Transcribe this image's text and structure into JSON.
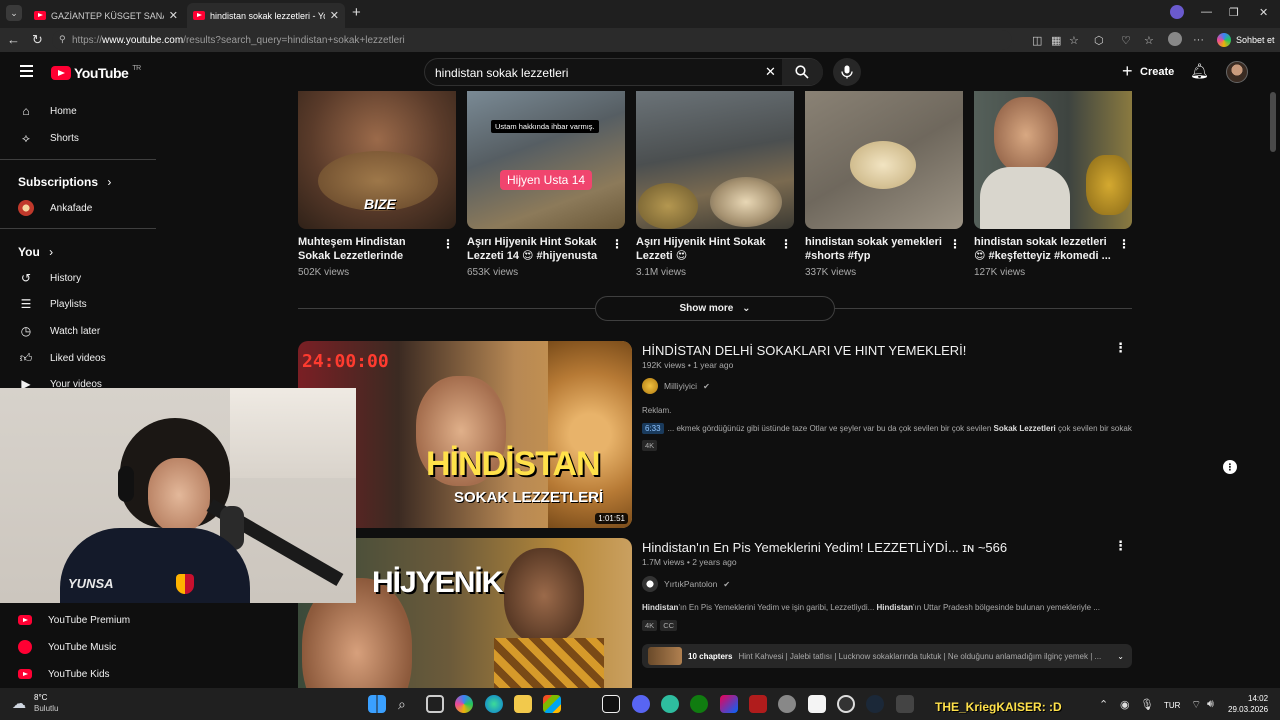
{
  "browser": {
    "tabs": [
      {
        "title": "GAZİANTEP KÜSGET SANAYİ LEZZ",
        "active": false
      },
      {
        "title": "hindistan sokak lezzetleri - YouTub",
        "active": true
      }
    ],
    "url_prefix": "https://",
    "url_host": "www.youtube.com",
    "url_path": "/results?search_query=hindistan+sokak+lezzetleri",
    "copilot_label": "Sohbet et"
  },
  "masthead": {
    "region": "TR",
    "brand": "YouTube",
    "search_value": "hindistan sokak lezzetleri",
    "create_label": "Create"
  },
  "sidebar": {
    "home": "Home",
    "shorts": "Shorts",
    "subscriptions_heading": "Subscriptions",
    "subscription_channel": "Ankafade",
    "you_heading": "You",
    "history": "History",
    "playlists": "Playlists",
    "watch_later": "Watch later",
    "liked_videos": "Liked videos",
    "your_videos": "Your videos",
    "premium": "YouTube Premium",
    "music": "YouTube Music",
    "kids": "YouTube Kids"
  },
  "shorts": [
    {
      "title": "Muhteşem Hindistan Sokak Lezzetlerinde Bugün..",
      "views": "502K views",
      "overlay": "BIZE"
    },
    {
      "title": "Aşırı Hijyenik Hint Sokak Lezzeti 14 😍 #hijyenusta",
      "views": "653K views",
      "overlay": "Hijyen Usta 14",
      "caption": "Ustam hakkında ihbar varmış."
    },
    {
      "title": "Aşırı Hijyenik Hint Sokak Lezzeti 😍",
      "views": "3.1M views"
    },
    {
      "title": "hindistan sokak yemekleri #shorts #fyp",
      "views": "337K views"
    },
    {
      "title": "hindistan sokak lezzetleri 😍 #keşfetteyiz #komedi ...",
      "views": "127K views"
    }
  ],
  "show_more_label": "Show more",
  "videos": [
    {
      "title": "HİNDİSTAN DELHİ SOKAKLARI VE HINT YEMEKLERİ!",
      "meta": "192K views • 1 year ago",
      "channel": "Milliyiyici",
      "desc_head": "Reklam.",
      "timestamp": "6:33",
      "desc_pre": "... ekmek gördüğünüz gibi üstünde taze Otlar ve şeyler var bu da çok sevilen bir çok sevilen ",
      "desc_bold": "Sokak Lezzetleri",
      "desc_post": " çok sevilen bir sokak...",
      "badges": [
        "4K"
      ],
      "duration": "1:01:51",
      "thumb_text_1": "HİNDİSTAN",
      "thumb_text_2": "SOKAK LEZZETLERİ",
      "thumb_clock": "24:00:00"
    },
    {
      "title": "Hindistan'ın En Pis Yemeklerini Yedim! LEZZETLİYDİ... ɪɴ ~566",
      "meta": "1.7M views • 2 years ago",
      "channel": "YırtıkPantolon",
      "desc_bold": "Hindistan",
      "desc_pre": "'ın En Pis Yemeklerini Yedim ve işin garibi, Lezzetliydi... ",
      "desc_bold2": "Hindistan",
      "desc_post": "'ın Uttar Pradesh bölgesinde bulunan yemekleriyle ...",
      "badges": [
        "4K",
        "CC"
      ],
      "thumb_text_1": "HİJYENİK",
      "chapters_count": "10 chapters",
      "chapters_text": "Hint Kahvesi | Jalebi tatlısı | Lucknow sokaklarında tuktuk | Ne olduğunu anlamadığım ilginç yemek | ..."
    }
  ],
  "webcam": {
    "shirt_text": "YUNSA"
  },
  "taskbar": {
    "weather_temp": "8°C",
    "weather_desc": "Bulutlu",
    "username_label": "THE_KriegKAISER: :D",
    "lang": "TUR",
    "time": "14:02",
    "date": "29.03.2026"
  },
  "colors": {
    "brand_red": "#ff0033",
    "background": "#0f0f0f"
  }
}
